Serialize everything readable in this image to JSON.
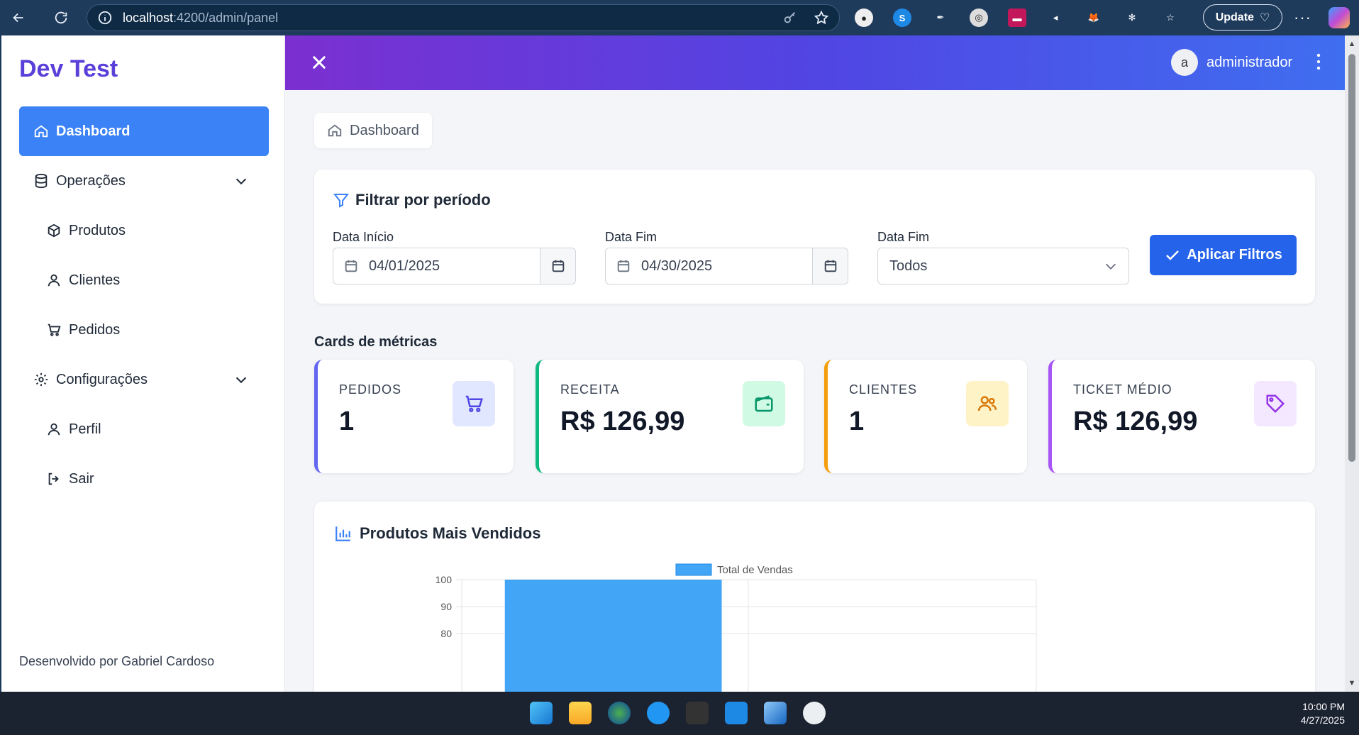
{
  "browser": {
    "url_host": "localhost",
    "url_path": ":4200/admin/panel",
    "update_label": "Update"
  },
  "sidebar": {
    "brand": "Dev Test",
    "items": [
      {
        "label": "Dashboard",
        "icon": "home-icon",
        "active": true
      },
      {
        "label": "Operações",
        "icon": "database-icon",
        "expandable": true
      },
      {
        "label": "Produtos",
        "icon": "box-icon",
        "sub": true
      },
      {
        "label": "Clientes",
        "icon": "user-icon",
        "sub": true
      },
      {
        "label": "Pedidos",
        "icon": "cart-icon",
        "sub": true
      },
      {
        "label": "Configurações",
        "icon": "gear-icon",
        "expandable": true
      },
      {
        "label": "Perfil",
        "icon": "user-icon",
        "sub": true
      },
      {
        "label": "Sair",
        "icon": "logout-icon",
        "sub": true
      }
    ],
    "footer": "Desenvolvido por Gabriel Cardoso"
  },
  "topbar": {
    "avatar_letter": "a",
    "username": "administrador"
  },
  "breadcrumb": {
    "label": "Dashboard"
  },
  "filter": {
    "title": "Filtrar por período",
    "start_label": "Data Início",
    "start_value": "04/01/2025",
    "end_label": "Data Fim",
    "end_value": "04/30/2025",
    "status_label": "Data Fim",
    "status_value": "Todos",
    "apply_label": "Aplicar Filtros"
  },
  "metrics_section": "Cards de métricas",
  "metrics": [
    {
      "label": "PEDIDOS",
      "value": "1",
      "accent": "#6366f1",
      "icon": "cart-icon",
      "icon_bg": "#e0e7ff",
      "icon_color": "#4f46e5"
    },
    {
      "label": "RECEITA",
      "value": "R$ 126,99",
      "accent": "#10b981",
      "icon": "wallet-icon",
      "icon_bg": "#d1fae5",
      "icon_color": "#059669"
    },
    {
      "label": "CLIENTES",
      "value": "1",
      "accent": "#f59e0b",
      "icon": "users-icon",
      "icon_bg": "#fef3c7",
      "icon_color": "#d97706"
    },
    {
      "label": "TICKET MÉDIO",
      "value": "R$ 126,99",
      "accent": "#a855f7",
      "icon": "tag-icon",
      "icon_bg": "#f3e8ff",
      "icon_color": "#9333ea"
    }
  ],
  "chart_card": {
    "title": "Produtos Mais Vendidos"
  },
  "chart_data": {
    "type": "bar",
    "legend_position": "top-center",
    "series": [
      {
        "name": "Total de Vendas",
        "color": "#42a5f5",
        "values": [
          100
        ]
      }
    ],
    "categories": [
      ""
    ],
    "ylim": [
      75,
      100
    ],
    "yticks": [
      100,
      90,
      80
    ],
    "grid": true
  },
  "taskbar": {
    "time": "10:00 PM",
    "date": "4/27/2025"
  }
}
